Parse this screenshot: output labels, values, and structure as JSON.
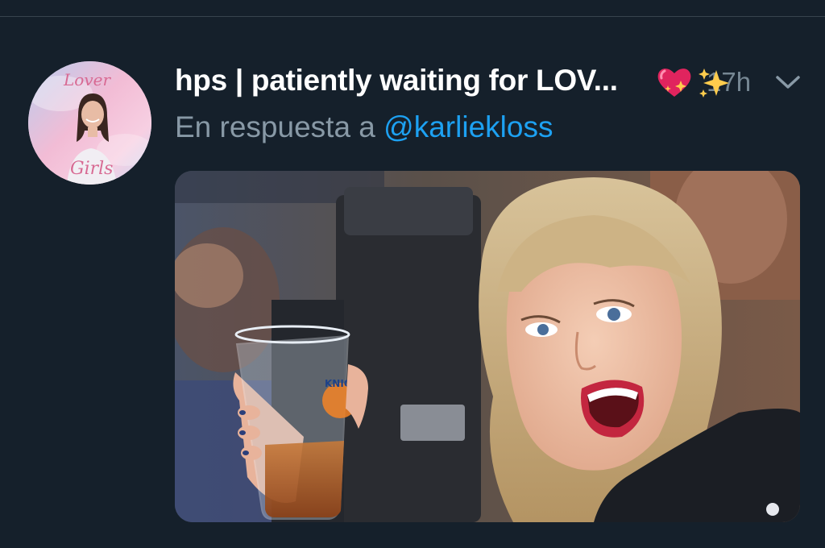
{
  "tweet": {
    "display_name": "hps | patiently waiting for LOV...",
    "timestamp": "17h",
    "reply_prefix": "En respuesta a",
    "reply_handle": "@karliekloss"
  },
  "avatar": {
    "top_text": "Lover",
    "bottom_text": "Girls"
  },
  "media": {
    "cup_logo_text": "KNICKS"
  },
  "icons": {
    "heart": "sparkling-heart-icon",
    "sparkles": "sparkles-icon",
    "caret": "chevron-down-icon"
  },
  "colors": {
    "background": "#15202b",
    "name_text": "#ffffff",
    "secondary_text": "#8899a6",
    "link": "#1da1f2"
  }
}
